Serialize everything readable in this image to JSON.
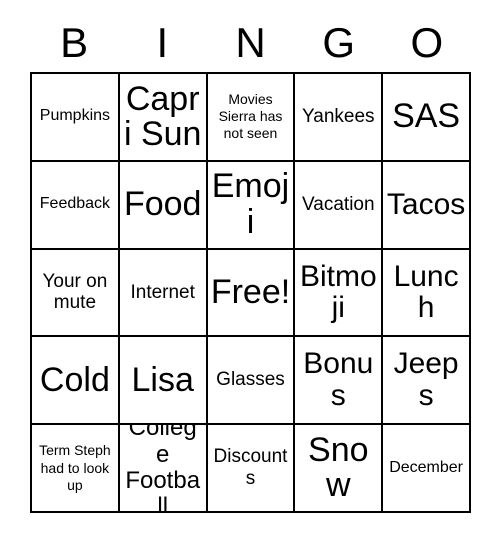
{
  "header": {
    "letters": [
      "B",
      "I",
      "N",
      "G",
      "O"
    ]
  },
  "style": {
    "background_color": "#ffffff",
    "border_color": "#000000",
    "text_color": "#000000"
  },
  "grid": {
    "rows": 5,
    "columns": 5,
    "cells": [
      {
        "text": "Pumpkins",
        "size": "sm"
      },
      {
        "text": "Capri Sun",
        "size": "xxl"
      },
      {
        "text": "Movies Sierra has not seen",
        "size": "xs"
      },
      {
        "text": "Yankees",
        "size": "md"
      },
      {
        "text": "SAS",
        "size": "xxl"
      },
      {
        "text": "Feedback",
        "size": "sm"
      },
      {
        "text": "Food",
        "size": "xxl"
      },
      {
        "text": "Emoji",
        "size": "xxl"
      },
      {
        "text": "Vacation",
        "size": "md"
      },
      {
        "text": "Tacos",
        "size": "xl"
      },
      {
        "text": "Your on mute",
        "size": "md"
      },
      {
        "text": "Internet",
        "size": "md"
      },
      {
        "text": "Free!",
        "size": "xxl"
      },
      {
        "text": "Bitmoji",
        "size": "xl"
      },
      {
        "text": "Lunch",
        "size": "xl"
      },
      {
        "text": "Cold",
        "size": "xxl"
      },
      {
        "text": "Lisa",
        "size": "xxl"
      },
      {
        "text": "Glasses",
        "size": "md"
      },
      {
        "text": "Bonus",
        "size": "xl"
      },
      {
        "text": "Jeeps",
        "size": "xl"
      },
      {
        "text": "Term Steph had to look up",
        "size": "xs"
      },
      {
        "text": "College Football",
        "size": "lg"
      },
      {
        "text": "Discounts",
        "size": "md"
      },
      {
        "text": "Snow",
        "size": "xxl"
      },
      {
        "text": "December",
        "size": "sm"
      }
    ]
  }
}
